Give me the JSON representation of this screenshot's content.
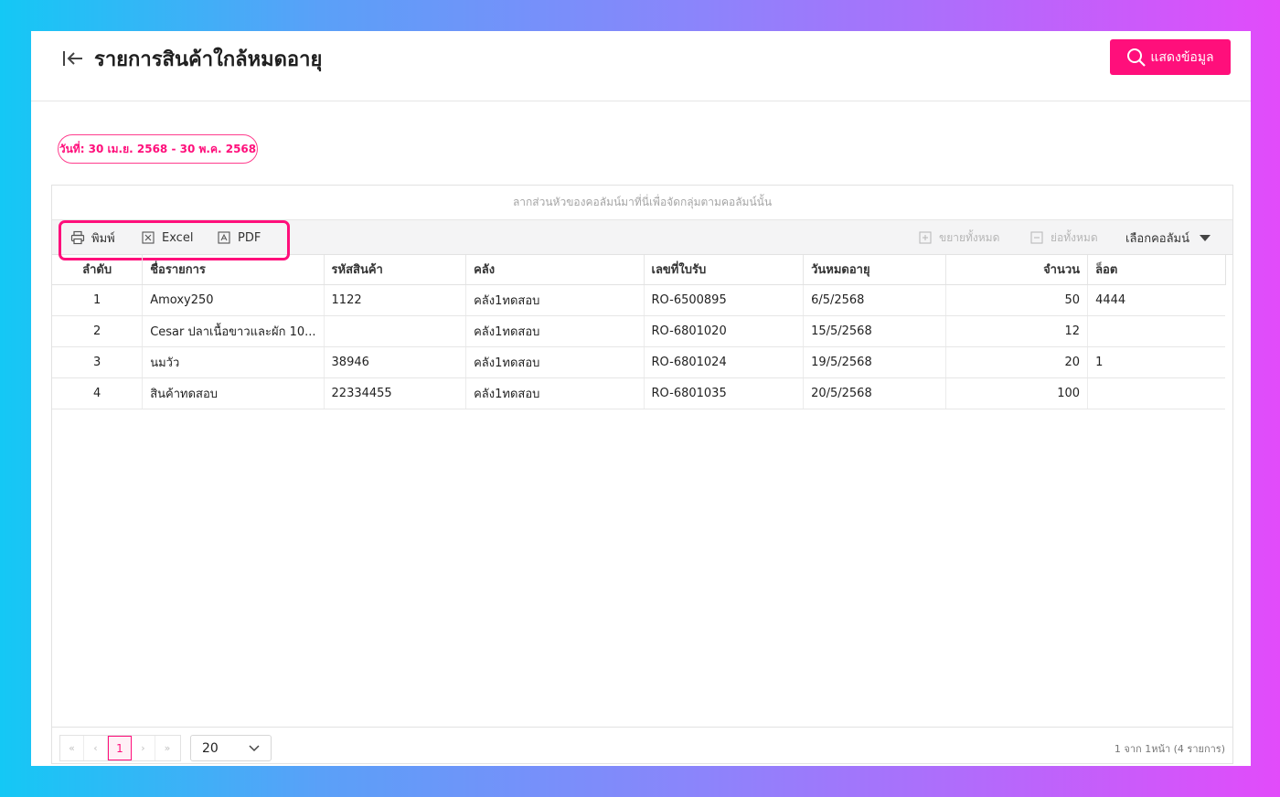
{
  "header": {
    "title": "รายการสินค้าใกล้หมดอายุ",
    "show_button": "แสดงข้อมูล"
  },
  "filter": {
    "date_range": "วันที่: 30 เม.ย. 2568 - 30 พ.ค. 2568"
  },
  "grid": {
    "group_panel_hint": "ลากส่วนหัวของคอลัมน์มาที่นี่เพื่อจัดกลุ่มตามคอลัมน์นั้น",
    "toolbar": {
      "print": "พิมพ์",
      "excel": "Excel",
      "pdf": "PDF",
      "expand_all": "ขยายทั้งหมด",
      "collapse_all": "ย่อทั้งหมด",
      "choose_columns": "เลือกคอลัมน์"
    },
    "columns": [
      "ลำดับ",
      "ชื่อรายการ",
      "รหัสสินค้า",
      "คลัง",
      "เลขที่ใบรับ",
      "วันหมดอายุ",
      "จำนวน",
      "ล็อต"
    ],
    "rows": [
      [
        "1",
        "Amoxy250",
        "1122",
        "คลัง1ทดสอบ",
        "RO-6500895",
        "6/5/2568",
        "50",
        "4444"
      ],
      [
        "2",
        "Cesar ปลาเนื้อขาวและผัก 10...",
        "",
        "คลัง1ทดสอบ",
        "RO-6801020",
        "15/5/2568",
        "12",
        ""
      ],
      [
        "3",
        "นมวัว",
        "38946",
        "คลัง1ทดสอบ",
        "RO-6801024",
        "19/5/2568",
        "20",
        "1"
      ],
      [
        "4",
        "สินค้าทดสอบ",
        "22334455",
        "คลัง1ทดสอบ",
        "RO-6801035",
        "20/5/2568",
        "100",
        ""
      ]
    ],
    "pager": {
      "first": "«",
      "prev": "‹",
      "current_page": "1",
      "next": "›",
      "last": "»",
      "page_size": "20",
      "info": "1 จาก 1หน้า (4 รายการ)"
    }
  },
  "colors": {
    "accent": "#ff0f7b"
  }
}
